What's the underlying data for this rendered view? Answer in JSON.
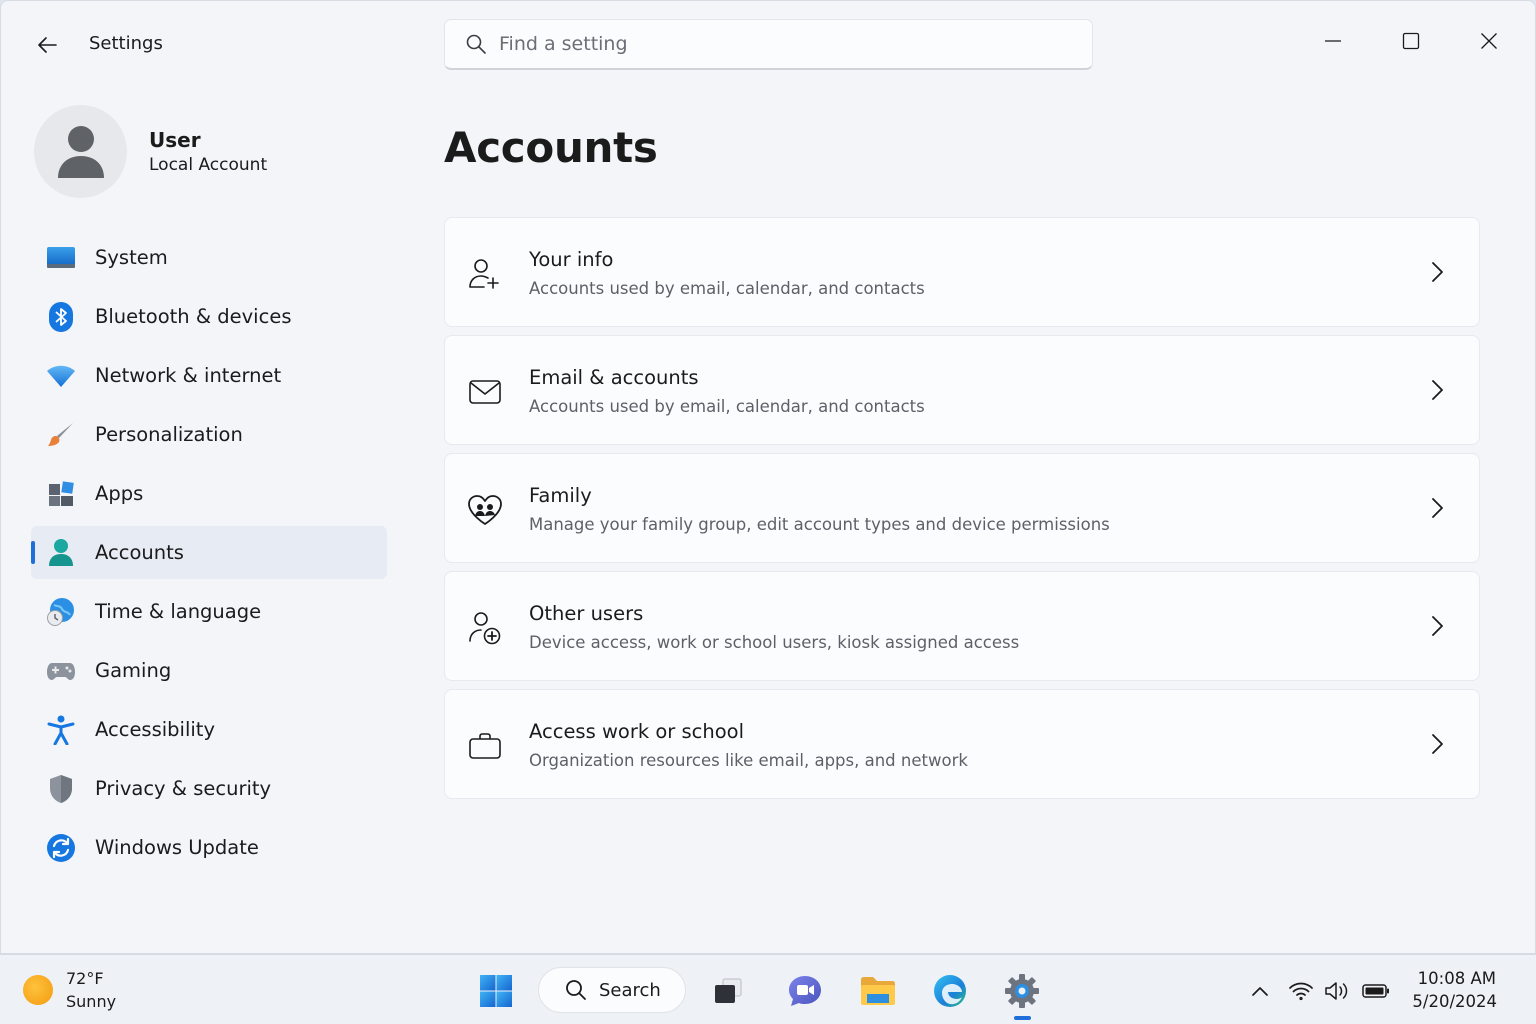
{
  "window": {
    "app_title": "Settings",
    "search_placeholder": "Find a setting"
  },
  "profile": {
    "name": "User",
    "account_type": "Local Account"
  },
  "nav": {
    "items": [
      {
        "label": "System",
        "icon": "monitor-icon"
      },
      {
        "label": "Bluetooth & devices",
        "icon": "bluetooth-icon"
      },
      {
        "label": "Network & internet",
        "icon": "wifi-icon"
      },
      {
        "label": "Personalization",
        "icon": "paintbrush-icon"
      },
      {
        "label": "Apps",
        "icon": "apps-grid-icon"
      },
      {
        "label": "Accounts",
        "icon": "person-icon",
        "selected": true
      },
      {
        "label": "Time & language",
        "icon": "globe-clock-icon"
      },
      {
        "label": "Gaming",
        "icon": "gamepad-icon"
      },
      {
        "label": "Accessibility",
        "icon": "accessibility-icon"
      },
      {
        "label": "Privacy & security",
        "icon": "shield-icon"
      },
      {
        "label": "Windows Update",
        "icon": "refresh-icon"
      }
    ]
  },
  "main": {
    "title": "Accounts",
    "cards": [
      {
        "title": "Your info",
        "subtitle": "Accounts used by email, calendar, and contacts",
        "icon": "person-add-icon"
      },
      {
        "title": "Email & accounts",
        "subtitle": "Accounts used by email, calendar, and contacts",
        "icon": "mail-icon"
      },
      {
        "title": "Family",
        "subtitle": "Manage your family group, edit account types and device permissions",
        "icon": "heart-people-icon"
      },
      {
        "title": "Other users",
        "subtitle": "Device access, work or school users, kiosk assigned access",
        "icon": "person-plus-circle-icon"
      },
      {
        "title": "Access work or school",
        "subtitle": "Organization resources like email, apps, and network",
        "icon": "briefcase-icon"
      }
    ]
  },
  "taskbar": {
    "weather_temp": "72°F",
    "weather_condition": "Sunny",
    "search_label": "Search",
    "time": "10:08 AM",
    "date": "5/20/2024"
  },
  "colors": {
    "accent": "#1e6fd9",
    "window_bg": "#f3f5f9",
    "card_bg": "#fbfcfd"
  }
}
